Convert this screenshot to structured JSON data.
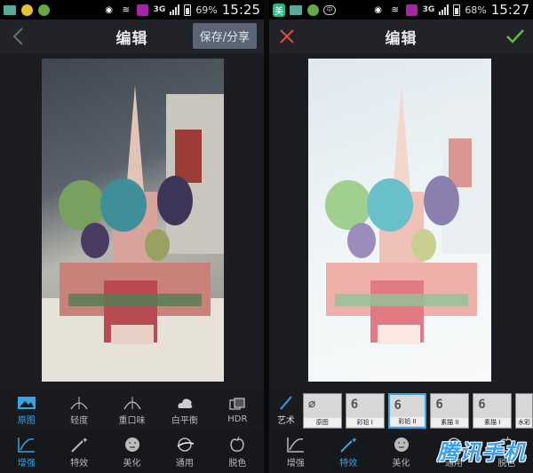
{
  "left": {
    "status": {
      "time": "15:25",
      "network": "3G",
      "battery": "69%"
    },
    "title": "编辑",
    "save_label": "保存/分享",
    "subtabs": [
      {
        "label": "原图",
        "icon": "image-icon",
        "active": true
      },
      {
        "label": "轻度",
        "icon": "light-curve-icon",
        "active": false
      },
      {
        "label": "重口味",
        "icon": "heavy-curve-icon",
        "active": false
      },
      {
        "label": "白平衡",
        "icon": "white-balance-icon",
        "active": false
      },
      {
        "label": "HDR",
        "icon": "hdr-icon",
        "active": false
      }
    ],
    "nav": [
      {
        "label": "增强",
        "icon": "enhance-icon",
        "active": true
      },
      {
        "label": "特效",
        "icon": "magic-wand-icon",
        "active": false
      },
      {
        "label": "美化",
        "icon": "face-icon",
        "active": false
      },
      {
        "label": "通用",
        "icon": "general-icon",
        "active": false
      },
      {
        "label": "脱色",
        "icon": "apple-icon",
        "active": false
      }
    ]
  },
  "right": {
    "status": {
      "time": "15:27",
      "network": "3G",
      "battery": "68%"
    },
    "title": "编辑",
    "art_label": "艺术",
    "filters": [
      {
        "label": "原图",
        "selected": false
      },
      {
        "label": "彩铅 I",
        "selected": false
      },
      {
        "label": "彩铅 II",
        "selected": true
      },
      {
        "label": "素描 II",
        "selected": false
      },
      {
        "label": "素描 I",
        "selected": false
      },
      {
        "label": "水彩",
        "selected": false
      }
    ],
    "nav": [
      {
        "label": "增强",
        "icon": "enhance-icon",
        "active": false
      },
      {
        "label": "特效",
        "icon": "magic-wand-icon",
        "active": true
      },
      {
        "label": "美化",
        "icon": "face-icon",
        "active": false
      },
      {
        "label": "通用",
        "icon": "general-icon",
        "active": false
      },
      {
        "label": "脱色",
        "icon": "apple-icon",
        "active": false
      }
    ],
    "watermark": "腾讯手机"
  },
  "colors": {
    "accent": "#38a3e8",
    "confirm": "#5cc23a",
    "cancel": "#e04848"
  }
}
